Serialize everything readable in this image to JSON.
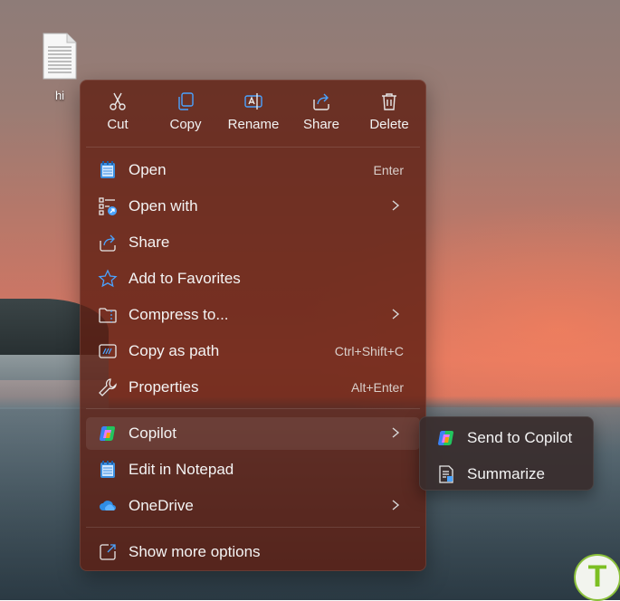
{
  "desktop": {
    "file_label": "hi",
    "file_icon": "text-document-icon"
  },
  "toolbar": {
    "cut_label": "Cut",
    "copy_label": "Copy",
    "rename_label": "Rename",
    "share_label": "Share",
    "delete_label": "Delete"
  },
  "menu": {
    "items": [
      {
        "label": "Open",
        "shortcut": "Enter",
        "icon": "notepad-icon"
      },
      {
        "label": "Open with",
        "shortcut": "",
        "icon": "open-with-icon",
        "has_submenu": true
      },
      {
        "label": "Share",
        "shortcut": "",
        "icon": "share-icon"
      },
      {
        "label": "Add to Favorites",
        "shortcut": "",
        "icon": "star-icon"
      },
      {
        "label": "Compress to...",
        "shortcut": "",
        "icon": "zip-folder-icon",
        "has_submenu": true
      },
      {
        "label": "Copy as path",
        "shortcut": "Ctrl+Shift+C",
        "icon": "copy-path-icon"
      },
      {
        "label": "Properties",
        "shortcut": "Alt+Enter",
        "icon": "wrench-icon"
      },
      {
        "label": "Copilot",
        "shortcut": "",
        "icon": "copilot-icon",
        "has_submenu": true,
        "highlighted": true
      },
      {
        "label": "Edit in Notepad",
        "shortcut": "",
        "icon": "notepad-icon"
      },
      {
        "label": "OneDrive",
        "shortcut": "",
        "icon": "onedrive-cloud-icon",
        "has_submenu": true
      },
      {
        "label": "Show more options",
        "shortcut": "",
        "icon": "show-more-icon"
      }
    ]
  },
  "submenu": {
    "items": [
      {
        "label": "Send to Copilot",
        "icon": "copilot-icon"
      },
      {
        "label": "Summarize",
        "icon": "summarize-icon"
      }
    ]
  },
  "watermark": {
    "letter": "T"
  },
  "colors": {
    "menu_bg": "#5f1e12",
    "submenu_bg": "#382d2c",
    "accent_blue": "#4aa3ff",
    "badge_green": "#7cbf22"
  }
}
